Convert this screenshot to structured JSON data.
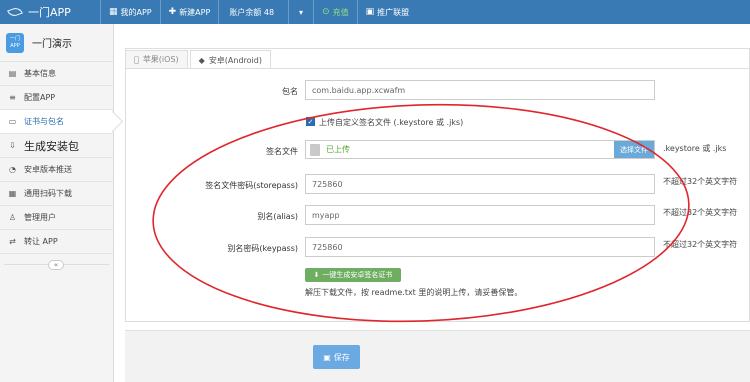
{
  "topnav": {
    "brand": "一门APP",
    "items": [
      {
        "icon": "grid-icon",
        "glyph": "▦",
        "label": "我的APP"
      },
      {
        "icon": "plus-icon",
        "glyph": "✚",
        "label": "新建APP"
      },
      {
        "label": "账户余额 48"
      },
      {
        "icon": "recharge-icon",
        "glyph": "⊙",
        "label": "充值"
      },
      {
        "icon": "promo-icon",
        "glyph": "▣",
        "label": "推广联盟"
      }
    ]
  },
  "sidebar": {
    "app_logo_line1": "一门",
    "app_logo_line2": "APP",
    "app_name": "一门演示",
    "items": [
      {
        "label": "基本信息",
        "glyph": "▤"
      },
      {
        "label": "配置APP",
        "glyph": "≡"
      },
      {
        "label": "证书与包名",
        "glyph": "▭"
      },
      {
        "label": "生成安装包",
        "glyph": "⇩"
      },
      {
        "label": "安卓版本推送",
        "glyph": "◔"
      },
      {
        "label": "通用扫码下载",
        "glyph": "▦"
      },
      {
        "label": "管理用户",
        "glyph": "♙"
      },
      {
        "label": "转让 APP",
        "glyph": "⇄"
      }
    ],
    "collapse_glyph": "«"
  },
  "tabs": [
    {
      "label": "苹果(iOS)",
      "glyph": ""
    },
    {
      "label": "安卓(Android)",
      "glyph": "◆"
    }
  ],
  "form": {
    "package_label": "包名",
    "package_value": "com.baidu.app.xcwafm",
    "custom_sign_checkbox": "上传自定义签名文件 (.keystore 或 .jks)",
    "sign_file_label": "签名文件",
    "sign_file_status": "已上传",
    "sign_file_button": "选择文件",
    "sign_file_hint": ".keystore 或 .jks",
    "storepass_label": "签名文件密码(storepass)",
    "storepass_value": "725860",
    "storepass_hint": "不超过32个英文字符",
    "alias_label": "别名(alias)",
    "alias_value": "myapp",
    "alias_hint": "不超过32个英文字符",
    "keypass_label": "别名密码(keypass)",
    "keypass_value": "725860",
    "keypass_hint": "不超过32个英文字符",
    "generate_button": "一键生成安卓签名证书",
    "note": "解压下载文件，按 readme.txt 里的说明上传，请妥善保管。",
    "save_button": "保存"
  },
  "colors": {
    "topnav": "#3a7ab4",
    "annotation": "#e0262b",
    "generate_button": "#6fae62",
    "save_button": "#6aa9e2"
  }
}
